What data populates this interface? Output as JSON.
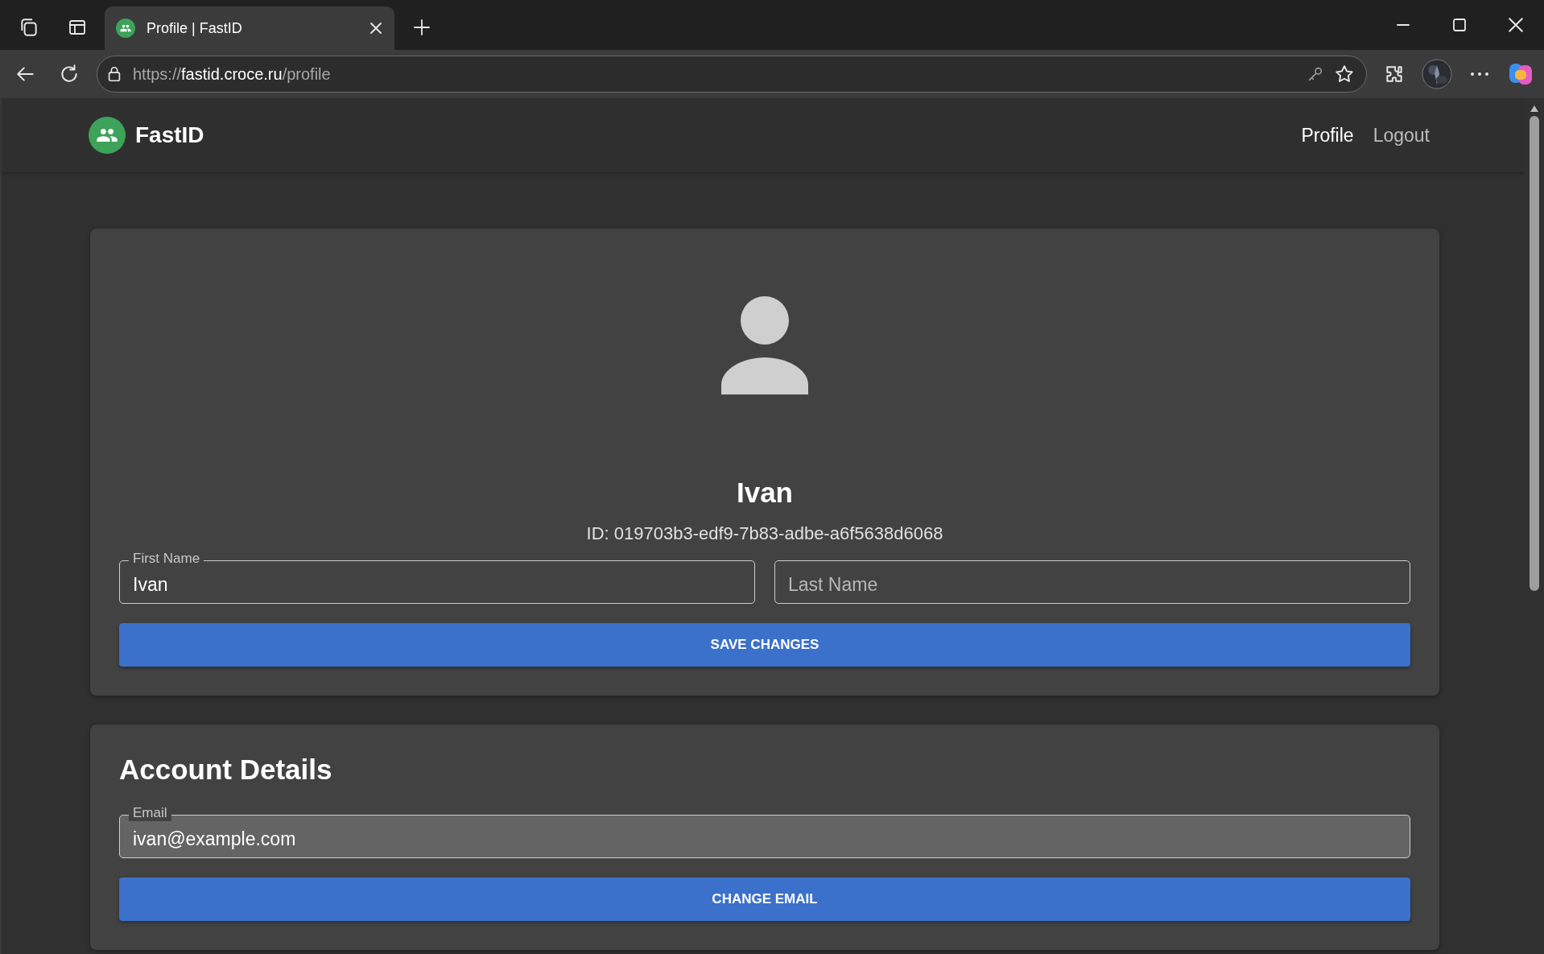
{
  "browser": {
    "tabs": [
      {
        "title": "Profile | FastID",
        "selected": true
      }
    ],
    "url": {
      "scheme": "https://",
      "host": "fastid.croce.ru",
      "path": "/profile"
    }
  },
  "header": {
    "brand": "FastID",
    "nav": [
      {
        "label": "Profile",
        "selected": true
      },
      {
        "label": "Logout",
        "selected": false
      }
    ]
  },
  "profile_card": {
    "name": "Ivan",
    "id_line": "ID: 019703b3-edf9-7b83-adbe-a6f5638d6068",
    "fields": [
      {
        "label": "First Name",
        "value": "Ivan",
        "readonly": false
      },
      {
        "placeholder": "Last Name",
        "readonly": false
      }
    ],
    "button": "SAVE CHANGES"
  },
  "account_card": {
    "title": "Account Details",
    "fields": [
      {
        "label": "Email",
        "value": "ivan@example.com",
        "readonly": true
      }
    ],
    "button": "CHANGE EMAIL"
  }
}
